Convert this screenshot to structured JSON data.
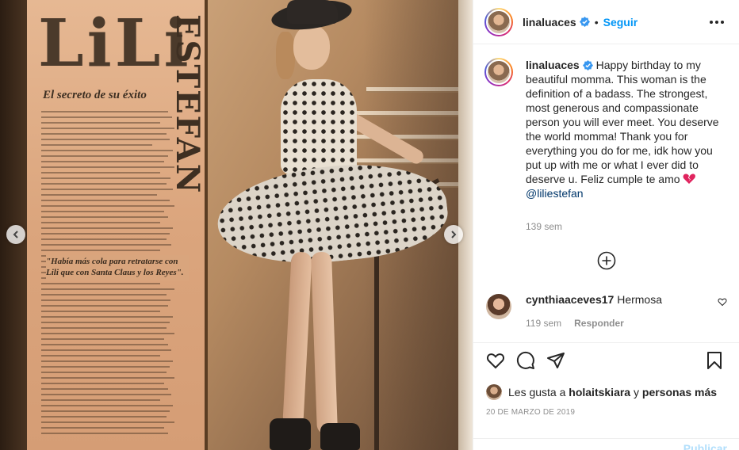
{
  "post": {
    "username": "linaluaces",
    "follow_label": "Seguir",
    "separator": "•",
    "caption": "Happy birthday to my beautiful momma. This woman is the definition of a badass. The strongest, most generous and compassionate person you will ever meet. You deserve the world momma! Thank you for everything you do for me, idk how you put up with me or what I ever did to deserve u. Feliz cumple te amo",
    "mention": "@liliestefan",
    "caption_time": "139 sem"
  },
  "media": {
    "clipping_title": "LiLi",
    "clipping_vertical": "ESTEFAN",
    "clipping_subtitle": "El secreto de su éxito",
    "clipping_quote": "\"Había más cola para retratarse con Lili que con Santa Claus y los Reyes\"."
  },
  "comment": {
    "username": "cynthiaaceves17",
    "text": "Hermosa",
    "time": "119 sem",
    "reply_label": "Responder"
  },
  "likes": {
    "prefix": "Les gusta a",
    "user": "holaitskiara",
    "joiner": "y",
    "others": "personas más"
  },
  "date": "20 DE MARZO DE 2019",
  "publish_label": "Publicar",
  "icons": [
    "chevron-left-icon",
    "chevron-right-icon",
    "verified-badge-icon",
    "more-options-icon",
    "plus-circle-icon",
    "heart-icon",
    "comment-icon",
    "share-icon",
    "bookmark-icon",
    "broken-heart-emoji"
  ],
  "colors": {
    "link": "#0095f6",
    "mention": "#00376b",
    "verified": "#3897f0",
    "muted": "#8e8e8e"
  }
}
